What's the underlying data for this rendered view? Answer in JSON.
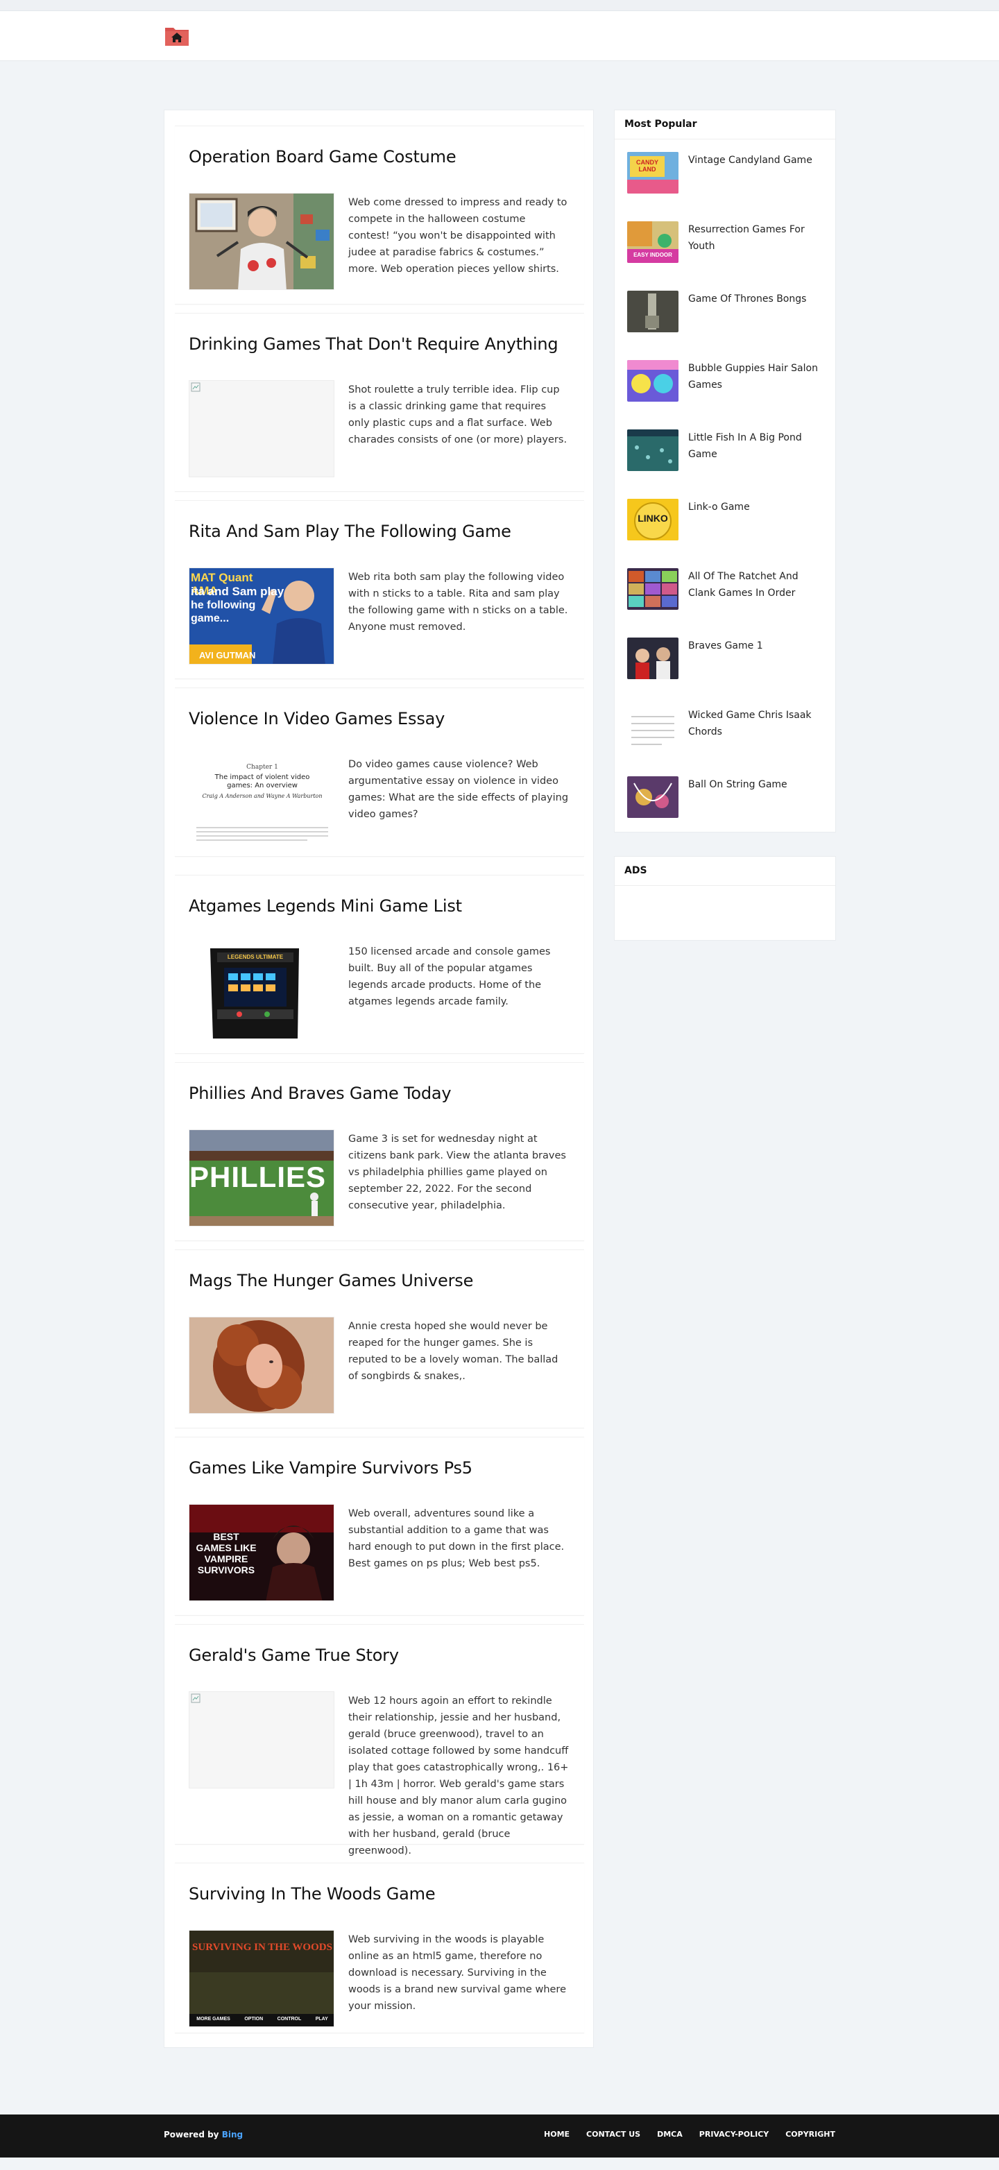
{
  "articles": [
    {
      "title": "Operation Board Game Costume",
      "text": "Web come dressed to impress and ready to compete in the halloween costume contest! “you won't be disappointed with judee at paradise fabrics & costumes.” more. Web operation pieces yellow shirts."
    },
    {
      "title": "Drinking Games That Don't Require Anything",
      "text": "Shot roulette a truly terrible idea. Flip cup is a classic drinking game that requires only plastic cups and a flat surface. Web charades consists of one (or more) players."
    },
    {
      "title": "Rita And Sam Play The Following Game",
      "text": "Web rita both sam play the following video with n sticks to a table. Rita and sam play the following game with n sticks on a table. Anyone must removed."
    },
    {
      "title": "Violence In Video Games Essay",
      "text": "Do video games cause violence? Web argumentative essay on violence in video games: What are the side effects of playing video games?"
    },
    {
      "title": "Atgames Legends Mini Game List",
      "text": "150 licensed arcade and console games built. Buy all of the popular atgames legends arcade products. Home of the atgames legends arcade family."
    },
    {
      "title": "Phillies And Braves Game Today",
      "text": "Game 3 is set for wednesday night at citizens bank park. View the atlanta braves vs philadelphia phillies game played on september 22, 2022. For the second consecutive year, philadelphia."
    },
    {
      "title": "Mags The Hunger Games Universe",
      "text": "Annie cresta hoped she would never be reaped for the hunger games. She is reputed to be a lovely woman. The ballad of songbirds & snakes,."
    },
    {
      "title": "Games Like Vampire Survivors Ps5",
      "text": "Web overall, adventures sound like a substantial addition to a game that was hard enough to put down in the first place. Best games on ps plus; Web best ps5."
    },
    {
      "title": "Gerald's Game True Story",
      "text": "Web 12 hours agoin an effort to rekindle their relationship, jessie and her husband, gerald (bruce greenwood), travel to an isolated cottage followed by some handcuff play that goes catastrophically wrong,. 16+ | 1h 43m | horror. Web gerald's game stars hill house and bly manor alum carla gugino as jessie, a woman on a romantic getaway with her husband, gerald (bruce greenwood)."
    },
    {
      "title": "Surviving In The Woods Game",
      "text": "Web surviving in the woods is playable online as an html5 game, therefore no download is necessary. Surviving in the woods is a brand new survival game where your mission."
    }
  ],
  "thumb_text": {
    "rita_banner_line1": "MAT Quant AMA",
    "rita_banner_line2": "ita and Sam play",
    "rita_banner_line3": "he following game...",
    "rita_name": "AVI GUTMAN",
    "legends": "LEGENDS ULTIMATE",
    "phillies": "PHILLIES",
    "vampire": "BEST GAMES LIKE VAMPIRE SURVIVORS",
    "woods_title": "SURVIVING IN THE WOODS",
    "woods_btn1": "MORE GAMES",
    "woods_btn2": "OPTION",
    "woods_btn3": "CONTROL",
    "woods_btn4": "PLAY",
    "essay_line1": "Chapter 1",
    "essay_line2": "The impact of violent video games: An overview",
    "essay_line3": "Craig A Anderson and Wayne A Warburton"
  },
  "sidebar": {
    "popular_title": "Most Popular",
    "popular": [
      {
        "label": "Vintage Candyland Game",
        "thumb_text": "CANDY LAND"
      },
      {
        "label": "Resurrection Games For Youth",
        "thumb_text": "EASY INDOOR"
      },
      {
        "label": "Game Of Thrones Bongs",
        "thumb_text": ""
      },
      {
        "label": "Bubble Guppies Hair Salon Games",
        "thumb_text": ""
      },
      {
        "label": "Little Fish In A Big Pond Game",
        "thumb_text": ""
      },
      {
        "label": "Link-o Game",
        "thumb_text": "LINKO"
      },
      {
        "label": "All Of The Ratchet And Clank Games In Order",
        "thumb_text": ""
      },
      {
        "label": "Braves Game 1",
        "thumb_text": ""
      },
      {
        "label": "Wicked Game Chris Isaak Chords",
        "thumb_text": ""
      },
      {
        "label": "Ball On String Game",
        "thumb_text": ""
      }
    ],
    "ads_title": "ADS"
  },
  "footer": {
    "powered_prefix": "Powered by",
    "powered_brand": "Bing",
    "links": [
      "HOME",
      "CONTACT US",
      "DMCA",
      "PRIVACY-POLICY",
      "COPYRIGHT"
    ]
  },
  "colors": {
    "accent": "#d9534f",
    "background": "#f1f4f7",
    "footer": "#151515",
    "bing": "#4aa3ff"
  },
  "icons": {
    "logo": "home-icon"
  }
}
